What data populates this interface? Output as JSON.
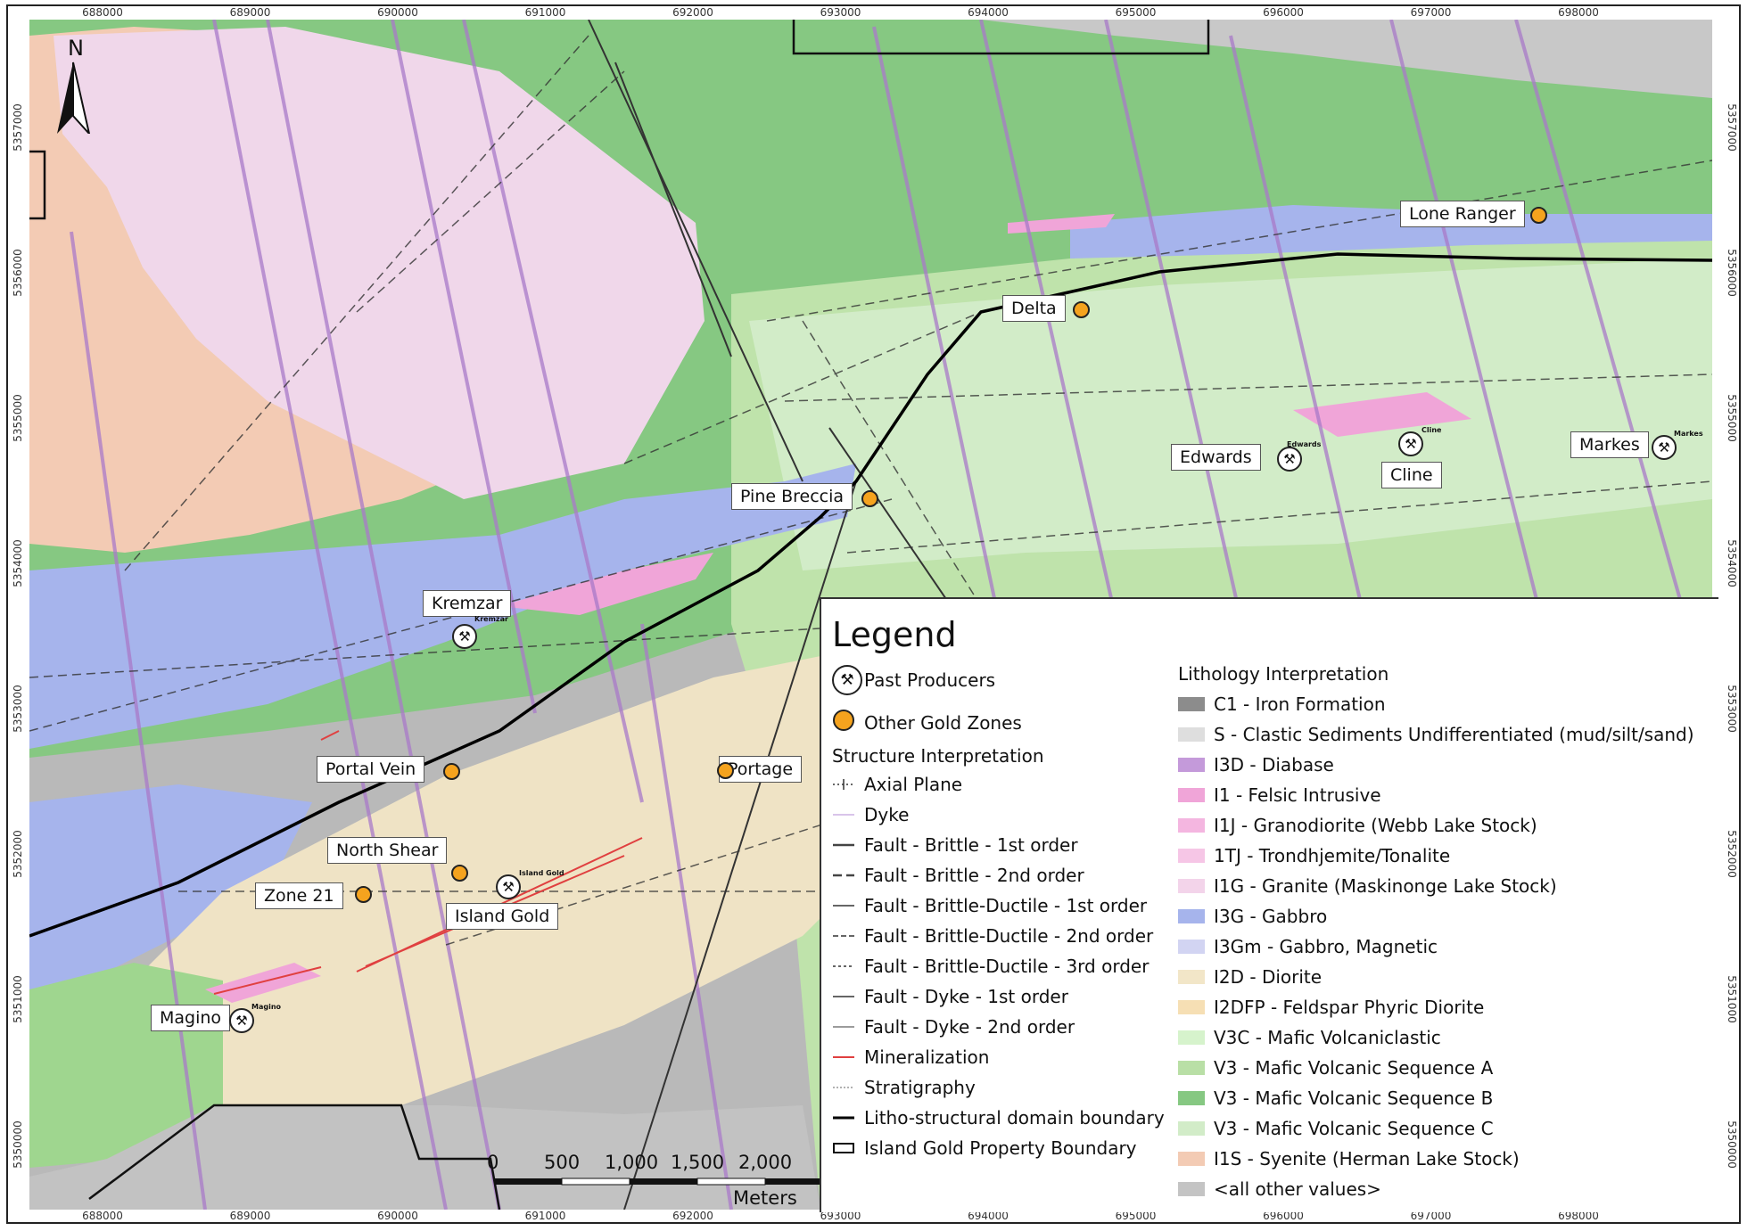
{
  "map": {
    "x_ticks": [
      "688000",
      "689000",
      "690000",
      "691000",
      "692000",
      "693000",
      "694000",
      "695000",
      "696000",
      "697000",
      "698000"
    ],
    "y_ticks": [
      "5357000",
      "5356000",
      "5355000",
      "5354000",
      "5353000",
      "5352000",
      "5351000",
      "5350000"
    ],
    "north": "N",
    "scale": {
      "ticks": [
        "0",
        "500",
        "1,000",
        "1,500",
        "2,000"
      ],
      "unit": "Meters"
    }
  },
  "sites": {
    "gold": [
      {
        "name": "Lone Ranger"
      },
      {
        "name": "Delta"
      },
      {
        "name": "Pine Breccia"
      },
      {
        "name": "Portal Vein"
      },
      {
        "name": "Portage"
      },
      {
        "name": "North Shear"
      },
      {
        "name": "Zone 21"
      }
    ],
    "past": [
      {
        "name": "Edwards",
        "tag": "Edwards"
      },
      {
        "name": "Cline",
        "tag": "Cline"
      },
      {
        "name": "Markes",
        "tag": "Markes"
      },
      {
        "name": "Kremzar",
        "tag": "Kremzar"
      },
      {
        "name": "Island Gold",
        "tag": "Island Gold"
      },
      {
        "name": "Magino",
        "tag": "Magino"
      }
    ]
  },
  "legend": {
    "title": "Legend",
    "past_producers": "Past Producers",
    "other_gold_zones": "Other Gold Zones",
    "structure_heading": "Structure Interpretation",
    "structure": [
      {
        "label": "Axial Plane"
      },
      {
        "label": "Dyke"
      },
      {
        "label": "Fault - Brittle - 1st order"
      },
      {
        "label": "Fault - Brittle - 2nd order"
      },
      {
        "label": "Fault - Brittle-Ductile - 1st order"
      },
      {
        "label": "Fault - Brittle-Ductile - 2nd order"
      },
      {
        "label": "Fault - Brittle-Ductile - 3rd order"
      },
      {
        "label": "Fault - Dyke - 1st order"
      },
      {
        "label": "Fault - Dyke - 2nd order"
      },
      {
        "label": "Mineralization"
      },
      {
        "label": "Stratigraphy"
      },
      {
        "label": "Litho-structural domain boundary"
      },
      {
        "label": "Island Gold Property Boundary"
      }
    ],
    "lithology_heading": "Lithology Interpretation",
    "lithology": [
      {
        "label": "C1 - Iron Formation",
        "color": "#8c8c8c"
      },
      {
        "label": "S - Clastic Sediments Undifferentiated (mud/silt/sand)",
        "color": "#dedede"
      },
      {
        "label": "I3D - Diabase",
        "color": "#c49ada"
      },
      {
        "label": "I1 - Felsic Intrusive",
        "color": "#f0a5d8"
      },
      {
        "label": "I1J - Granodiorite (Webb Lake Stock)",
        "color": "#f4b6e0"
      },
      {
        "label": "1TJ - Trondhjemite/Tonalite",
        "color": "#f6c6e6"
      },
      {
        "label": "I1G - Granite (Maskinonge Lake Stock)",
        "color": "#f3d4ea"
      },
      {
        "label": "I3G - Gabbro",
        "color": "#a6b4ec"
      },
      {
        "label": "I3Gm - Gabbro, Magnetic",
        "color": "#d2d4f2"
      },
      {
        "label": "I2D - Diorite",
        "color": "#f2e6c8"
      },
      {
        "label": "I2DFP - Feldspar Phyric Diorite",
        "color": "#f6dfb4"
      },
      {
        "label": "V3C - Mafic Volcaniclastic",
        "color": "#d6f3cc"
      },
      {
        "label": "V3 - Mafic Volcanic Sequence A",
        "color": "#b9dfa6"
      },
      {
        "label": "V3 - Mafic Volcanic Sequence B",
        "color": "#86c882"
      },
      {
        "label": "V3 - Mafic Volcanic Sequence C",
        "color": "#d2ecc8"
      },
      {
        "label": "I1S - Syenite (Herman Lake Stock)",
        "color": "#f3cbb4"
      },
      {
        "label": "<all other values>",
        "color": "#c4c4c4"
      }
    ]
  }
}
